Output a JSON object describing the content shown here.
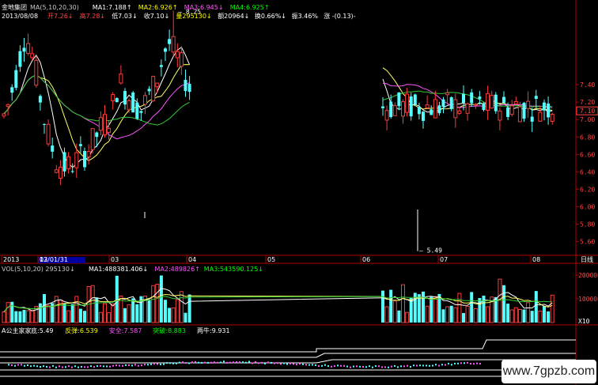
{
  "header": {
    "stock_name": "金地集团",
    "ma_line": [
      {
        "text": "MA(5,10,20,30)",
        "color": "#c8c8c8"
      },
      {
        "text": "MA1:7.188↑",
        "color": "#ffffff"
      },
      {
        "text": "MA2:6.926↑",
        "color": "#ffff00"
      },
      {
        "text": "MA3:6.945↓",
        "color": "#ff55ff"
      },
      {
        "text": "MA4:6.925↑",
        "color": "#00ff00"
      }
    ],
    "date": "2013/08/08",
    "price_info": [
      {
        "text": "开7.26↓",
        "color": "#ff4444"
      },
      {
        "text": "高7.28↓",
        "color": "#ff4444"
      },
      {
        "text": "低7.03↓",
        "color": "#ffffff"
      },
      {
        "text": "收7.10↓",
        "color": "#ffffff"
      },
      {
        "text": "量295130↓",
        "color": "#ffff00"
      },
      {
        "text": "额20964↓",
        "color": "#ffffff"
      },
      {
        "text": "换0.66%↓",
        "color": "#ffffff"
      },
      {
        "text": "振3.46%",
        "color": "#ffffff"
      },
      {
        "text": "涨 -(0.13)-",
        "color": "#ffffff"
      }
    ]
  },
  "annotations": {
    "high_label": "8.25",
    "low_label": "5.49",
    "period": "日线"
  },
  "price_axis": {
    "ticks": [
      "7.40",
      "7.20",
      "7.00",
      "6.80",
      "6.60",
      "6.40",
      "6.20",
      "6.00",
      "5.80",
      "5.60"
    ],
    "current": "7.10"
  },
  "time_axis": {
    "labels": [
      "2013",
      "13/01/31",
      "02",
      "03",
      "04",
      "05",
      "06",
      "07",
      "08"
    ]
  },
  "volume_panel": {
    "title": [
      {
        "text": "VOL(5,10,20) 295130↓",
        "color": "#c8c8c8"
      },
      {
        "text": "MA1:488381.406↓",
        "color": "#ffffff"
      },
      {
        "text": "MA2:489826↑",
        "color": "#ff55ff"
      },
      {
        "text": "MA3:543590.125↓",
        "color": "#00ff00"
      }
    ],
    "ticks": [
      "200000",
      "100000",
      "X10"
    ]
  },
  "indicator_panel": {
    "title": [
      {
        "text": "A公主家家",
        "color": "#ffffff"
      },
      {
        "text": "底:5.49",
        "color": "#ffffff"
      },
      {
        "text": "反弹:6.539",
        "color": "#ffff00"
      },
      {
        "text": "安全:7.587",
        "color": "#ff55ff"
      },
      {
        "text": "突破:8.883",
        "color": "#00ff00"
      },
      {
        "text": "两牛:9.931",
        "color": "#ffffff"
      }
    ]
  },
  "watermark": "www.7gpzb.com",
  "chart_data": {
    "type": "candlestick",
    "title": "金地集团",
    "x_labels": [
      "2013",
      "13/01/31",
      "02",
      "03",
      "04",
      "05",
      "06",
      "07",
      "08"
    ],
    "ylim": [
      5.45,
      8.3
    ],
    "last_close": 7.1,
    "ma_periods": [
      5,
      10,
      20,
      30
    ],
    "high": 8.25,
    "low": 5.49,
    "volume_ylim": [
      0,
      220000
    ],
    "volume_ticks": [
      100000,
      200000
    ]
  }
}
